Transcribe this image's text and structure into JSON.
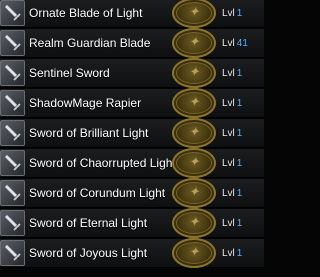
{
  "list": {
    "level_label": "Lvl",
    "items": [
      {
        "name": "Ornate Blade of Light",
        "level": "1",
        "icon": "sword-icon"
      },
      {
        "name": "Realm Guardian Blade",
        "level": "41",
        "icon": "sword-icon"
      },
      {
        "name": "Sentinel Sword",
        "level": "1",
        "icon": "sword-icon"
      },
      {
        "name": "ShadowMage Rapier",
        "level": "1",
        "icon": "sword-icon"
      },
      {
        "name": "Sword of Brilliant Light",
        "level": "1",
        "icon": "sword-icon"
      },
      {
        "name": "Sword of Chaorrupted Light",
        "level": "1",
        "icon": "sword-icon"
      },
      {
        "name": "Sword of Corundum Light",
        "level": "1",
        "icon": "sword-icon"
      },
      {
        "name": "Sword of Eternal Light",
        "level": "1",
        "icon": "sword-icon"
      },
      {
        "name": "Sword of Joyous Light",
        "level": "1",
        "icon": "sword-icon"
      }
    ]
  },
  "colors": {
    "level_number": "#4fb1ff",
    "emblem_gold": "#8a7430",
    "row_bg": "#141516"
  }
}
